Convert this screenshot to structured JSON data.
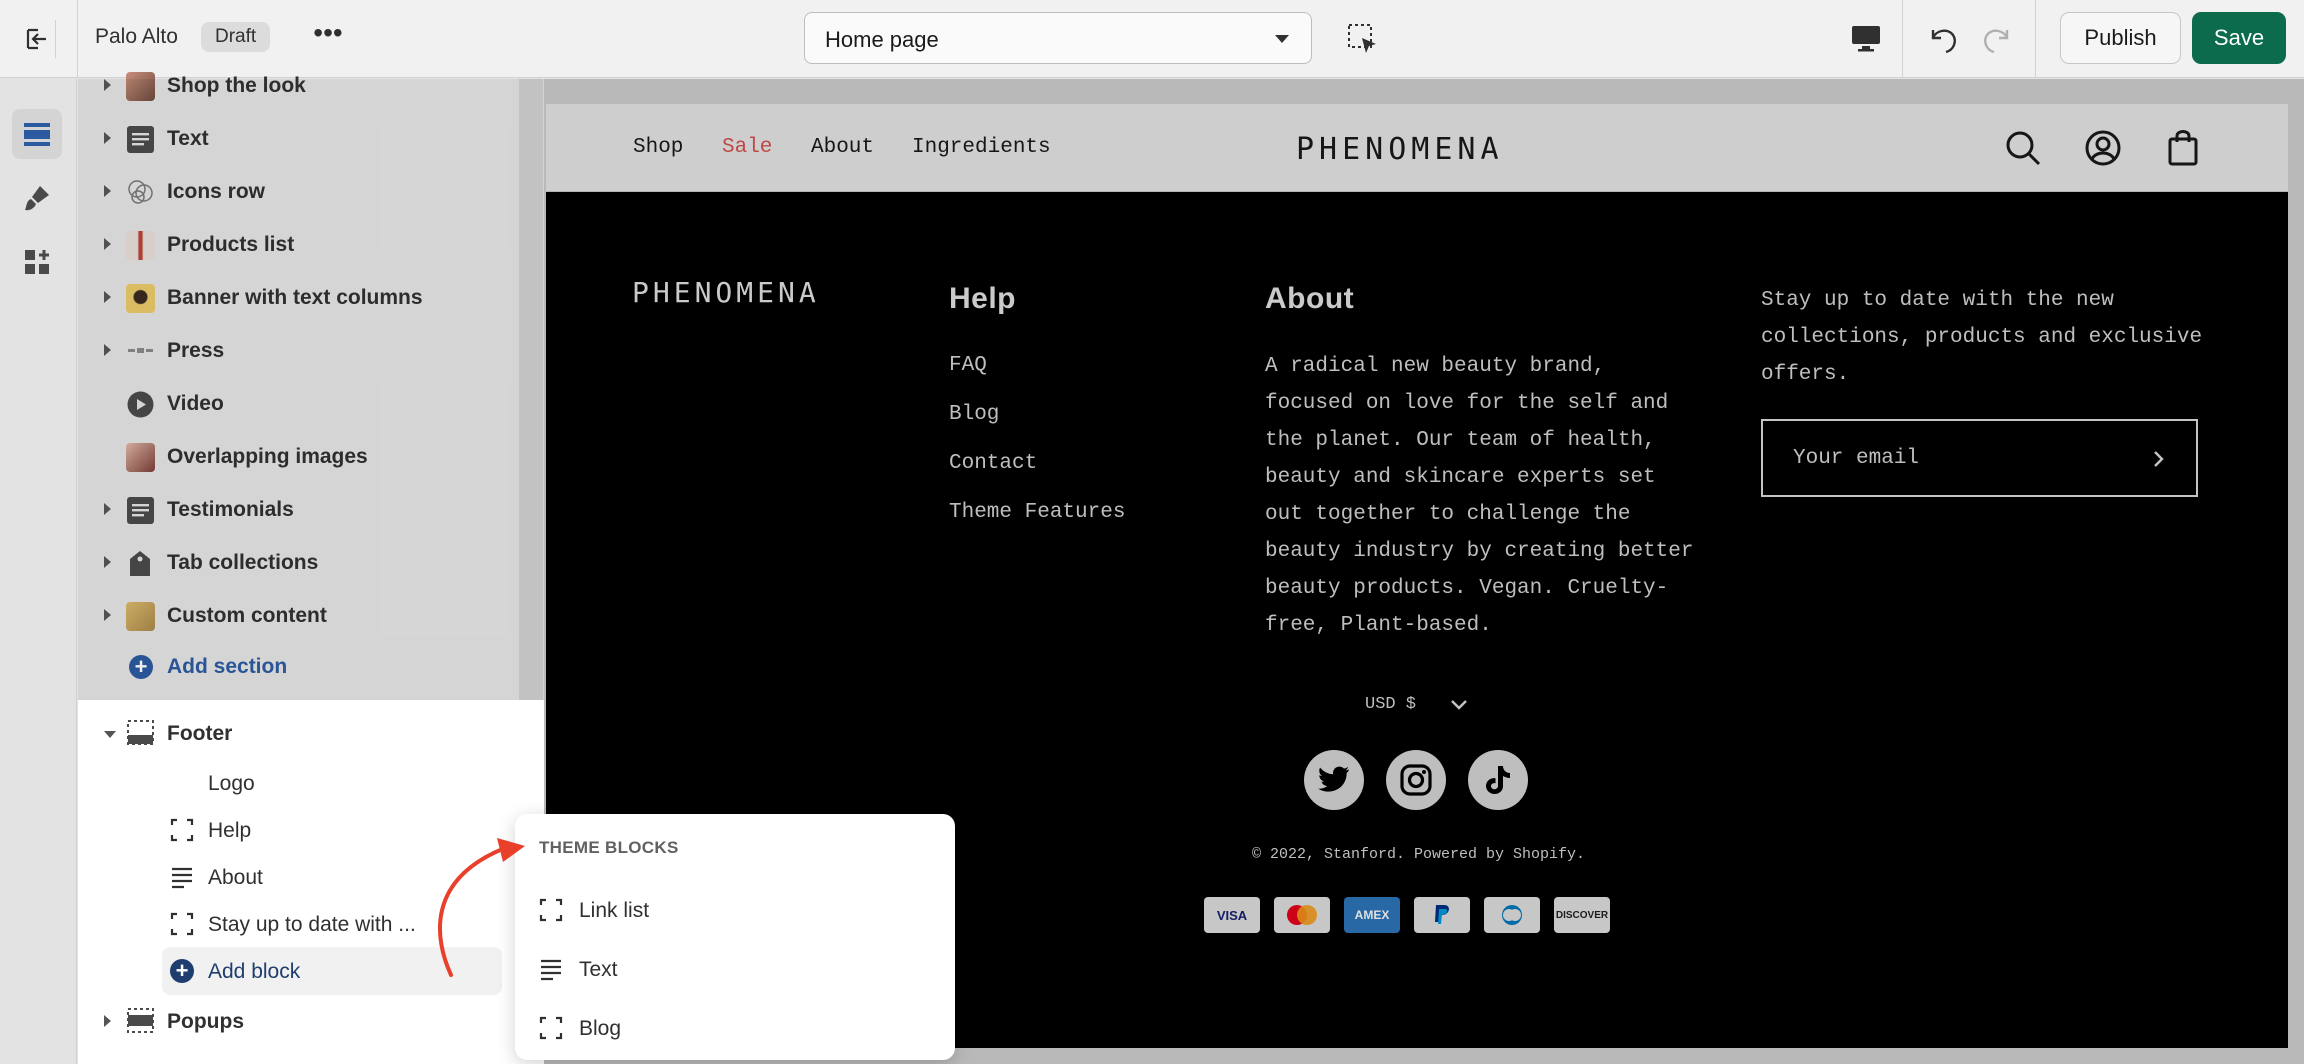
{
  "topbar": {
    "store_name": "Palo Alto",
    "draft_label": "Draft",
    "more_label": "•••",
    "page_select": "Home page",
    "publish_label": "Publish",
    "save_label": "Save",
    "accent": "#0b6b4c"
  },
  "rail": {
    "items": [
      "sections-icon",
      "theme-settings-icon",
      "app-embeds-icon"
    ]
  },
  "sidebar": {
    "sections": [
      {
        "label": "Shop the look",
        "icon": "image-thumb"
      },
      {
        "label": "Text",
        "icon": "text-icon"
      },
      {
        "label": "Icons row",
        "icon": "icons-thumb"
      },
      {
        "label": "Products list",
        "icon": "image-thumb"
      },
      {
        "label": "Banner with text columns",
        "icon": "image-thumb"
      },
      {
        "label": "Press",
        "icon": "press-thumb"
      },
      {
        "label": "Video",
        "icon": "play-icon"
      },
      {
        "label": "Overlapping images",
        "icon": "image-thumb"
      },
      {
        "label": "Testimonials",
        "icon": "text-icon"
      },
      {
        "label": "Tab collections",
        "icon": "tag-icon"
      },
      {
        "label": "Custom content",
        "icon": "image-thumb"
      }
    ],
    "add_section": "Add section",
    "footer": {
      "label": "Footer",
      "blocks": [
        {
          "label": "Logo"
        },
        {
          "label": "Help"
        },
        {
          "label": "About"
        },
        {
          "label": "Stay up to date with ..."
        }
      ],
      "add_block": "Add block"
    },
    "popups_label": "Popups"
  },
  "popover": {
    "title": "THEME BLOCKS",
    "items": [
      "Link list",
      "Text",
      "Blog"
    ]
  },
  "preview": {
    "nav": [
      {
        "label": "Shop",
        "color": "#1a1a1a"
      },
      {
        "label": "Sale",
        "color": "#d9534f"
      },
      {
        "label": "About",
        "color": "#1a1a1a"
      },
      {
        "label": "Ingredients",
        "color": "#1a1a1a"
      }
    ],
    "logo": "PHENOMENA",
    "footer": {
      "logo": "PHENOMENA",
      "help_heading": "Help",
      "help_links": [
        "FAQ",
        "Blog",
        "Contact",
        "Theme Features"
      ],
      "about_heading": "About",
      "about_text": "A radical new beauty brand, focused on love for the self and the planet. Our team of health, beauty and skincare experts set out together to challenge the beauty industry by creating better beauty products. Vegan. Cruelty-free, Plant-based.",
      "newsletter_text": "Stay up to date with the new collections, products and exclusive offers.",
      "email_placeholder": "Your email",
      "currency": "USD $",
      "copyright": "© 2022, Stanford. Powered by Shopify.",
      "payments": [
        "VISA",
        "Mastercard",
        "AMEX",
        "PayPal",
        "Diners",
        "DISCOVER"
      ]
    }
  }
}
